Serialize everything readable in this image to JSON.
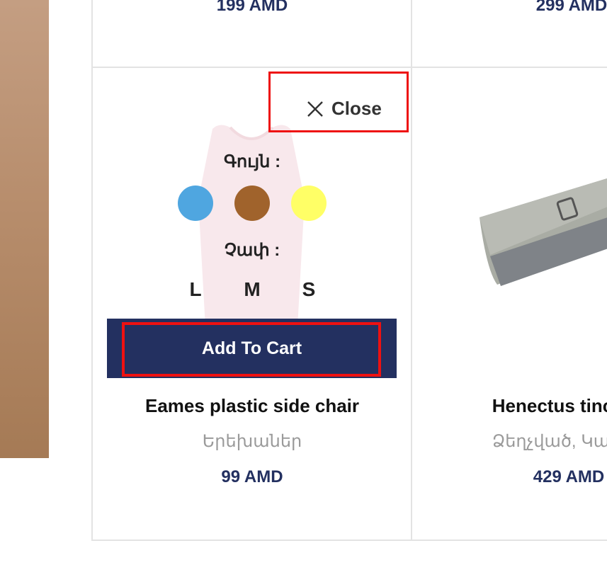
{
  "top_row": {
    "left_price": "199 AMD",
    "right_price": "299 AMD"
  },
  "card_left": {
    "close_label": "Close",
    "color_label": "Գույն :",
    "colors": [
      "#4fa6e0",
      "#a0632c",
      "#ffff66"
    ],
    "size_label": "Չափ :",
    "sizes": [
      "L",
      "M",
      "S"
    ],
    "add_to_cart": "Add To Cart",
    "name": "Eames plastic side chair",
    "category": "Երեխաներ",
    "price": "99 AMD"
  },
  "card_right": {
    "name": "Henectus tinc",
    "category": "Ձեղչված, Կա",
    "price": "429 AMD"
  },
  "colors": {
    "accent": "#233060",
    "highlight": "#ee1111"
  }
}
